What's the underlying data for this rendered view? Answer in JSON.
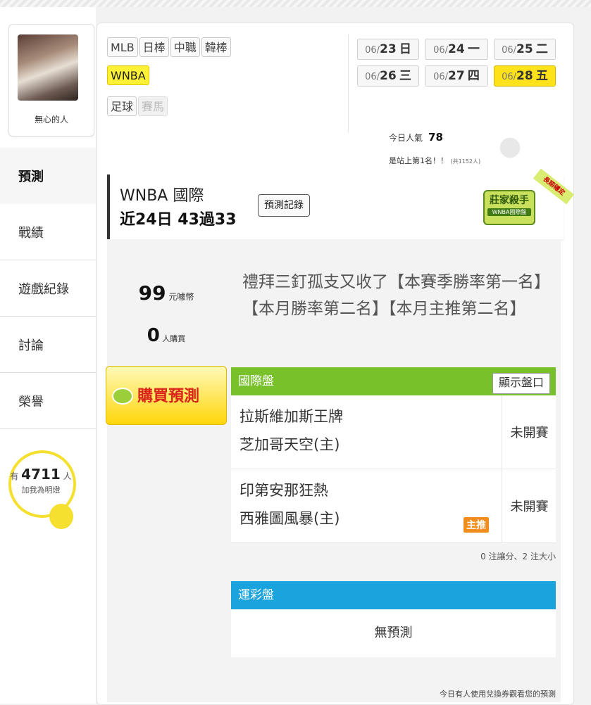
{
  "user": {
    "name": "無心的人"
  },
  "nav": [
    {
      "label": "預測",
      "active": true
    },
    {
      "label": "戰績",
      "active": false
    },
    {
      "label": "遊戲紀錄",
      "active": false
    },
    {
      "label": "討論",
      "active": false
    },
    {
      "label": "榮譽",
      "active": false
    }
  ],
  "fans": {
    "prefix": "有",
    "count": "4711",
    "suffix": "人",
    "sub": "加我為明燈"
  },
  "leagues": {
    "row1": [
      "MLB",
      "日棒",
      "中職",
      "韓棒"
    ],
    "row2": [
      "WNBA"
    ],
    "row3": [
      "足球",
      "賽馬"
    ]
  },
  "dates": [
    {
      "md": "06/",
      "day": "23",
      "wd": "日"
    },
    {
      "md": "06/",
      "day": "24",
      "wd": "一"
    },
    {
      "md": "06/",
      "day": "25",
      "wd": "二"
    },
    {
      "md": "06/",
      "day": "26",
      "wd": "三"
    },
    {
      "md": "06/",
      "day": "27",
      "wd": "四"
    },
    {
      "md": "06/",
      "day": "28",
      "wd": "五",
      "active": true
    }
  ],
  "popularity": {
    "label": "今日人氣",
    "value": "78",
    "rank": "是站上第1名！！",
    "total": "(共1152人)"
  },
  "header": {
    "title": "WNBA 國際",
    "record": "近24日 43過33",
    "record_button": "預測記錄",
    "badge_title": "莊家殺手",
    "badge_sub": "WNBA國際盤",
    "ribbon": "長期穩定"
  },
  "price": {
    "value": "99",
    "unit": "元噱幣",
    "buyers": "0",
    "buyers_unit": "人購買"
  },
  "buy_button": "購買預測",
  "description": "禮拜三釘孤支又收了【本賽季勝率第一名】【本月勝率第二名】【本月主推第二名】",
  "intl": {
    "title": "國際盤",
    "show_button": "顯示盤口",
    "games": [
      {
        "away": "拉斯維加斯王牌",
        "home": "芝加哥天空(主)",
        "status": "未開賽",
        "tag": ""
      },
      {
        "away": "印第安那狂熱",
        "home": "西雅圖風暴(主)",
        "status": "未開賽",
        "tag": "主推"
      }
    ],
    "note": "0 注讓分、2 注大小"
  },
  "lottery": {
    "title": "運彩盤",
    "empty": "無預測"
  },
  "footnote": "今日有人使用兌換券觀看您的預測"
}
